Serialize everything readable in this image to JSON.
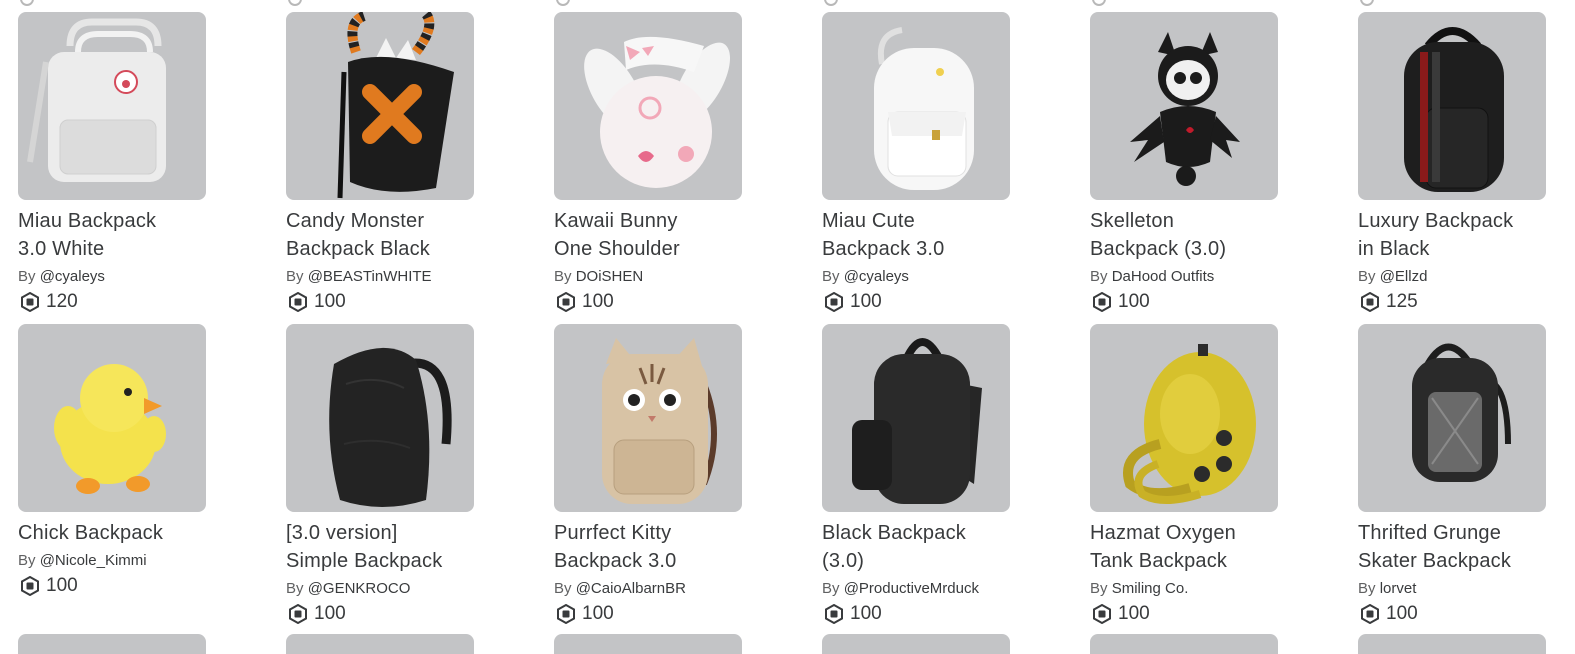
{
  "colors": {
    "thumb_bg": "#c3c4c6",
    "text_primary": "#393b3d",
    "text_secondary": "#606162"
  },
  "currency_icon": "robux-icon",
  "items": [
    {
      "name": "Miau Backpack 3.0 White",
      "name_l1": "Miau Backpack",
      "name_l2": "3.0 White",
      "by": "By",
      "creator": "@cyaleys",
      "price": "120",
      "thumb": "white-kanken-backpack"
    },
    {
      "name": "Candy Monster Backpack Black",
      "name_l1": "Candy Monster",
      "name_l2": "Backpack Black",
      "by": "By",
      "creator": "@BEASTinWHITE",
      "price": "100",
      "thumb": "candy-monster-backpack"
    },
    {
      "name": "Kawaii Bunny One Shoulder",
      "name_l1": "Kawaii Bunny",
      "name_l2": "One Shoulder",
      "by": "By",
      "creator": "DOiSHEN",
      "price": "100",
      "thumb": "bunny-backpack"
    },
    {
      "name": "Miau Cute Backpack 3.0",
      "name_l1": "Miau Cute",
      "name_l2": "Backpack 3.0",
      "by": "By",
      "creator": "@cyaleys",
      "price": "100",
      "thumb": "white-cute-backpack"
    },
    {
      "name": "Skelleton Backpack (3.0)",
      "name_l1": "Skelleton",
      "name_l2": "Backpack (3.0)",
      "by": "By",
      "creator": "DaHood Outfits",
      "price": "100",
      "thumb": "skeleton-cat-backpack"
    },
    {
      "name": "Luxury Backpack in Black",
      "name_l1": "Luxury Backpack",
      "name_l2": "in Black",
      "by": "By",
      "creator": "@Ellzd",
      "price": "125",
      "thumb": "black-striped-backpack"
    },
    {
      "name": "Chick Backpack",
      "name_l1": "Chick Backpack",
      "name_l2": "",
      "by": "By",
      "creator": "@Nicole_Kimmi",
      "price": "100",
      "thumb": "chick-backpack"
    },
    {
      "name": "[3.0 version] Simple Backpack",
      "name_l1": "[3.0 version]",
      "name_l2": "Simple Backpack",
      "by": "By",
      "creator": "@GENKROCO",
      "price": "100",
      "thumb": "black-simple-backpack"
    },
    {
      "name": "Purrfect Kitty Backpack 3.0",
      "name_l1": "Purrfect Kitty",
      "name_l2": "Backpack 3.0",
      "by": "By",
      "creator": "@CaioAlbarnBR",
      "price": "100",
      "thumb": "kitty-backpack"
    },
    {
      "name": "Black Backpack (3.0)",
      "name_l1": "Black Backpack",
      "name_l2": "(3.0)",
      "by": "By",
      "creator": "@ProductiveMrduck",
      "price": "100",
      "thumb": "black-backpack"
    },
    {
      "name": "Hazmat Oxygen Tank Backpack",
      "name_l1": "Hazmat Oxygen",
      "name_l2": "Tank Backpack",
      "by": "By",
      "creator": "Smiling Co.",
      "price": "100",
      "thumb": "hazmat-tank-backpack"
    },
    {
      "name": "Thrifted Grunge Skater Backpack",
      "name_l1": "Thrifted Grunge",
      "name_l2": "Skater Backpack",
      "by": "By",
      "creator": "lorvet",
      "price": "100",
      "thumb": "grunge-skater-backpack"
    }
  ]
}
